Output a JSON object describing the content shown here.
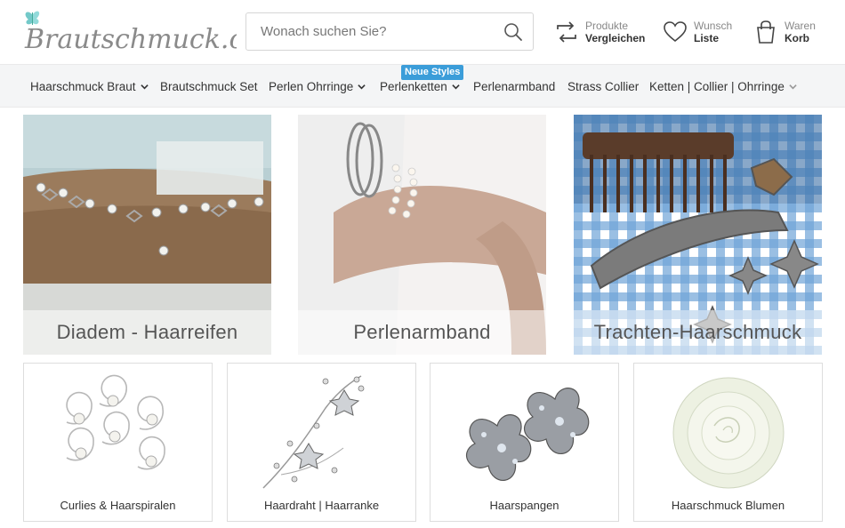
{
  "logo": {
    "text": "Brautschmuck.org"
  },
  "search": {
    "placeholder": "Wonach suchen Sie?"
  },
  "header_actions": [
    {
      "line1": "Produkte",
      "line2": "Vergleichen",
      "icon": "compare-icon"
    },
    {
      "line1": "Wunsch",
      "line2": "Liste",
      "icon": "heart-icon"
    },
    {
      "line1": "Waren",
      "line2": "Korb",
      "icon": "shopping-bag-icon"
    }
  ],
  "nav": {
    "badge": "Neue Styles",
    "items": [
      {
        "label": "Haarschmuck Braut",
        "dropdown": true
      },
      {
        "label": "Brautschmuck Set",
        "dropdown": false
      },
      {
        "label": "Perlen Ohrringe",
        "dropdown": true
      },
      {
        "label": "Perlenketten",
        "dropdown": true
      },
      {
        "label": "Perlenarmband",
        "dropdown": false
      },
      {
        "label": "Strass Collier",
        "dropdown": false
      },
      {
        "label": "Ketten | Collier | Ohrringe",
        "dropdown": true
      }
    ]
  },
  "banners": [
    {
      "caption": "Diadem - Haarreifen"
    },
    {
      "caption": "Perlenarmband"
    },
    {
      "caption": "Trachten-Haarschmuck"
    }
  ],
  "categories": [
    {
      "label": "Curlies & Haarspiralen"
    },
    {
      "label": "Haardraht | Haarranke"
    },
    {
      "label": "Haarspangen"
    },
    {
      "label": "Haarschmuck Blumen"
    }
  ],
  "colors": {
    "accent": "#3b9dd9",
    "nav_bg": "#f4f5f6",
    "logo": "#8a8a8a",
    "logo_butterfly": "#5bbfc0"
  }
}
